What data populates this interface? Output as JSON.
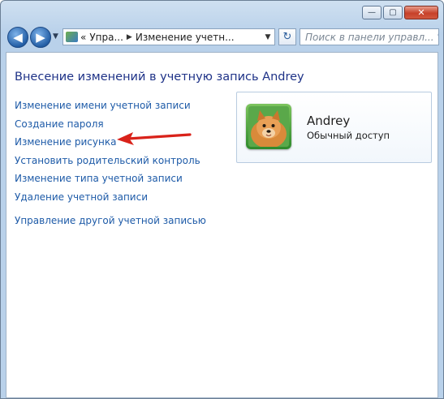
{
  "window": {
    "minimize_glyph": "—",
    "maximize_glyph": "▢",
    "close_glyph": "✕"
  },
  "toolbar": {
    "back_glyph": "◀",
    "forward_glyph": "▶",
    "address": {
      "chevron": "«",
      "crumb_1": "Упра...",
      "crumb_2": "Изменение учетн...",
      "separator": "▶",
      "dropdown_glyph": "▼"
    },
    "refresh_glyph": "↻",
    "search_placeholder": "Поиск в панели управл...",
    "search_icon": "search-icon"
  },
  "page": {
    "title": "Внесение изменений в учетную запись Andrey",
    "tasks": [
      "Изменение имени учетной записи",
      "Создание пароля",
      "Изменение рисунка",
      "Установить родительский контроль",
      "Изменение типа учетной записи",
      "Удаление учетной записи"
    ],
    "other_task": "Управление другой учетной записью"
  },
  "user": {
    "name": "Andrey",
    "account_type": "Обычный доступ"
  },
  "annotation": {
    "arrow_color": "#d9221a"
  }
}
